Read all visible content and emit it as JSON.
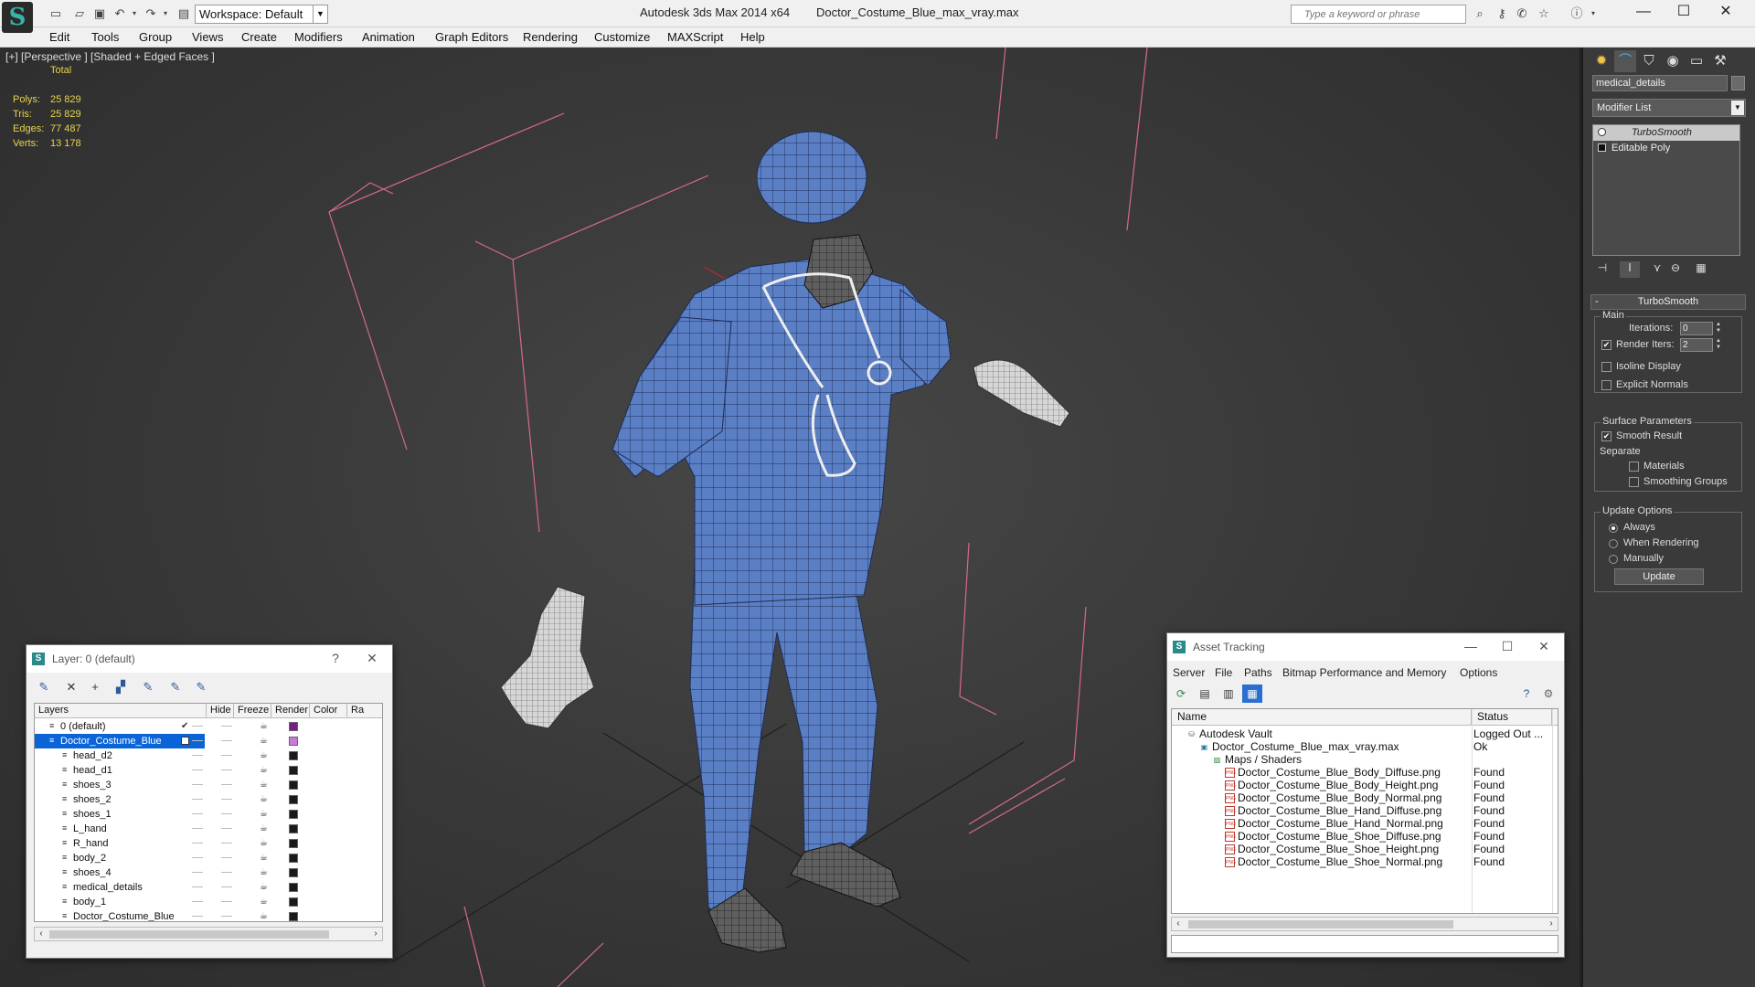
{
  "app": {
    "title": "Autodesk 3ds Max 2014 x64",
    "file": "Doctor_Costume_Blue_max_vray.max",
    "workspace": "Workspace: Default",
    "search_placeholder": "Type a keyword or phrase"
  },
  "menu": [
    "Edit",
    "Tools",
    "Group",
    "Views",
    "Create",
    "Modifiers",
    "Animation",
    "Graph Editors",
    "Rendering",
    "Customize",
    "MAXScript",
    "Help"
  ],
  "viewport": {
    "label": "[+] [Perspective ] [Shaded + Edged Faces ]",
    "stats": {
      "total_label": "Total",
      "rows": [
        {
          "label": "Polys:",
          "value": "25 829"
        },
        {
          "label": "Tris:",
          "value": "25 829"
        },
        {
          "label": "Edges:",
          "value": "77 487"
        },
        {
          "label": "Verts:",
          "value": "13 178"
        }
      ]
    }
  },
  "command_panel": {
    "object_name": "medical_details",
    "modifier_list": "Modifier List",
    "stack": [
      "TurboSmooth",
      "Editable Poly"
    ],
    "rollout_title": "TurboSmooth",
    "main": {
      "title": "Main",
      "iterations_label": "Iterations:",
      "iterations_value": "0",
      "render_iters_label": "Render Iters:",
      "render_iters_value": "2",
      "isoline_label": "Isoline Display",
      "explicit_normals_label": "Explicit Normals"
    },
    "surface": {
      "title": "Surface Parameters",
      "smooth_result_label": "Smooth Result",
      "separate_label": "Separate",
      "materials_label": "Materials",
      "smoothing_groups_label": "Smoothing Groups"
    },
    "update": {
      "title": "Update Options",
      "always_label": "Always",
      "when_rendering_label": "When Rendering",
      "manually_label": "Manually",
      "update_button": "Update"
    }
  },
  "layer_window": {
    "title": "Layer: 0 (default)",
    "help": "?",
    "columns": [
      "Layers",
      "Hide",
      "Freeze",
      "Render",
      "Color",
      "Ra"
    ],
    "layers": [
      {
        "name": "0 (default)",
        "level": 1,
        "color": "#7a1f8a",
        "selected": false,
        "checked": true
      },
      {
        "name": "Doctor_Costume_Blue",
        "level": 1,
        "color": "#c77ad8",
        "selected": true,
        "checked": false
      },
      {
        "name": "head_d2",
        "level": 2,
        "color": "#1a1a1a"
      },
      {
        "name": "head_d1",
        "level": 2,
        "color": "#1a1a1a"
      },
      {
        "name": "shoes_3",
        "level": 2,
        "color": "#1a1a1a"
      },
      {
        "name": "shoes_2",
        "level": 2,
        "color": "#1a1a1a"
      },
      {
        "name": "shoes_1",
        "level": 2,
        "color": "#1a1a1a"
      },
      {
        "name": "L_hand",
        "level": 2,
        "color": "#1a1a1a"
      },
      {
        "name": "R_hand",
        "level": 2,
        "color": "#1a1a1a"
      },
      {
        "name": "body_2",
        "level": 2,
        "color": "#1a1a1a"
      },
      {
        "name": "shoes_4",
        "level": 2,
        "color": "#1a1a1a"
      },
      {
        "name": "medical_details",
        "level": 2,
        "color": "#1a1a1a"
      },
      {
        "name": "body_1",
        "level": 2,
        "color": "#1a1a1a"
      },
      {
        "name": "Doctor_Costume_Blue",
        "level": 2,
        "color": "#1a1a1a"
      }
    ]
  },
  "asset_window": {
    "title": "Asset Tracking",
    "menu": [
      "Server",
      "File",
      "Paths",
      "Bitmap Performance and Memory",
      "Options"
    ],
    "columns": [
      "Name",
      "Status"
    ],
    "rows": [
      {
        "name": "Autodesk Vault",
        "status": "Logged Out ...",
        "level": 0,
        "icon": "vault-icon"
      },
      {
        "name": "Doctor_Costume_Blue_max_vray.max",
        "status": "Ok",
        "level": 1,
        "icon": "max-file-icon"
      },
      {
        "name": "Maps / Shaders",
        "status": "",
        "level": 2,
        "icon": "maps-icon"
      },
      {
        "name": "Doctor_Costume_Blue_Body_Diffuse.png",
        "status": "Found",
        "level": 3,
        "icon": "png-icon"
      },
      {
        "name": "Doctor_Costume_Blue_Body_Height.png",
        "status": "Found",
        "level": 3,
        "icon": "png-icon"
      },
      {
        "name": "Doctor_Costume_Blue_Body_Normal.png",
        "status": "Found",
        "level": 3,
        "icon": "png-icon"
      },
      {
        "name": "Doctor_Costume_Blue_Hand_Diffuse.png",
        "status": "Found",
        "level": 3,
        "icon": "png-icon"
      },
      {
        "name": "Doctor_Costume_Blue_Hand_Normal.png",
        "status": "Found",
        "level": 3,
        "icon": "png-icon"
      },
      {
        "name": "Doctor_Costume_Blue_Shoe_Diffuse.png",
        "status": "Found",
        "level": 3,
        "icon": "png-icon"
      },
      {
        "name": "Doctor_Costume_Blue_Shoe_Height.png",
        "status": "Found",
        "level": 3,
        "icon": "png-icon"
      },
      {
        "name": "Doctor_Costume_Blue_Shoe_Normal.png",
        "status": "Found",
        "level": 3,
        "icon": "png-icon"
      }
    ]
  },
  "colors": {
    "accent": "#0a64d8",
    "stats_text": "#e8d44a",
    "model_blue": "#5b7fc4",
    "bbox_pink": "#d46a8a"
  }
}
